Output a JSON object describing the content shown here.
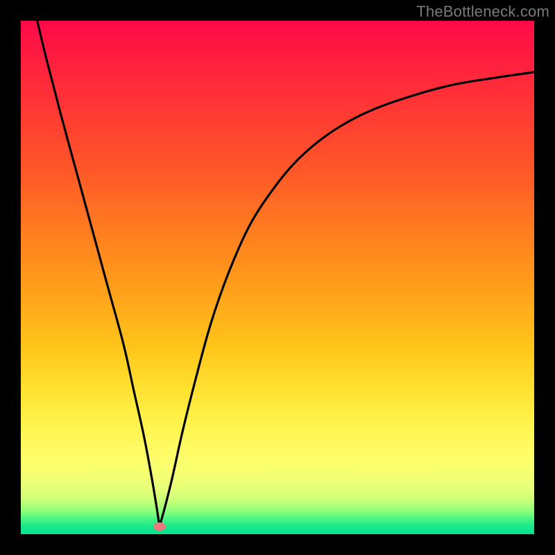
{
  "watermark": {
    "text": "TheBottleneck.com"
  },
  "colors": {
    "background": "#000000",
    "curve": "#000000",
    "trough_dot": "#eb7a7d",
    "watermark": "#7a7a7a",
    "gradient_top": "#ff0a47",
    "gradient_bottom": "#07e38d"
  },
  "chart_data": {
    "type": "line",
    "title": "",
    "xlabel": "",
    "ylabel": "",
    "xlim": [
      0,
      100
    ],
    "ylim": [
      0,
      100
    ],
    "grid": false,
    "legend": false,
    "annotations": [
      {
        "kind": "trough-marker",
        "x": 27,
        "y": 1.5
      }
    ],
    "series": [
      {
        "name": "curve-left",
        "x": [
          3.2,
          5,
          8,
          11,
          14,
          17,
          20,
          22,
          24,
          25.5,
          26.5,
          27
        ],
        "values": [
          100,
          92.5,
          81,
          70,
          59,
          48,
          37,
          28,
          19,
          11,
          5,
          1.5
        ]
      },
      {
        "name": "curve-right",
        "x": [
          27,
          28,
          29.5,
          31.5,
          34,
          37,
          40.5,
          44.5,
          49,
          54,
          60,
          67,
          75,
          84,
          93,
          100
        ],
        "values": [
          1.5,
          5,
          11,
          20,
          30,
          41,
          51,
          60,
          67,
          73,
          78,
          82,
          85,
          87.5,
          89,
          90
        ]
      }
    ]
  }
}
